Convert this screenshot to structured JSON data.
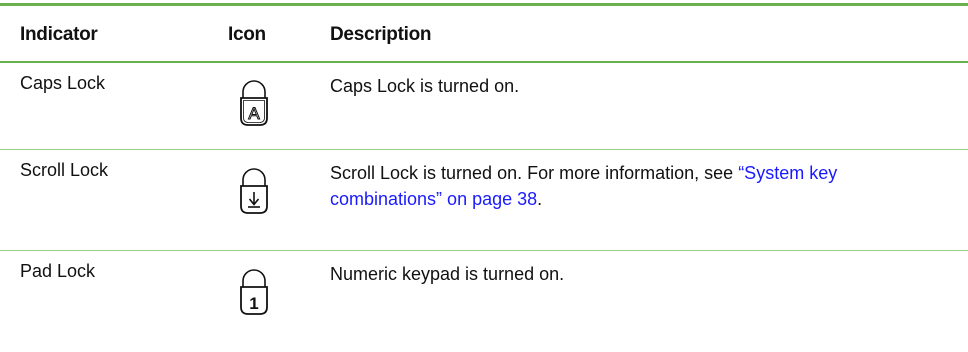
{
  "table": {
    "headers": {
      "indicator": "Indicator",
      "icon": "Icon",
      "description": "Description"
    },
    "rows": [
      {
        "indicator": "Caps Lock",
        "icon": "caps-lock-icon",
        "icon_glyph": "A",
        "description": "Caps Lock is turned on.",
        "link_text": "",
        "after_link": ""
      },
      {
        "indicator": "Scroll Lock",
        "icon": "scroll-lock-icon",
        "icon_glyph": "",
        "description": "Scroll Lock is turned on. For more information, see ",
        "link_text": "“System key combinations” on page 38",
        "after_link": "."
      },
      {
        "indicator": "Pad Lock",
        "icon": "pad-lock-icon",
        "icon_glyph": "1",
        "description": "Numeric keypad is turned on.",
        "link_text": "",
        "after_link": ""
      }
    ]
  },
  "colors": {
    "rule": "#6ab04c",
    "link": "#1a1aff"
  }
}
